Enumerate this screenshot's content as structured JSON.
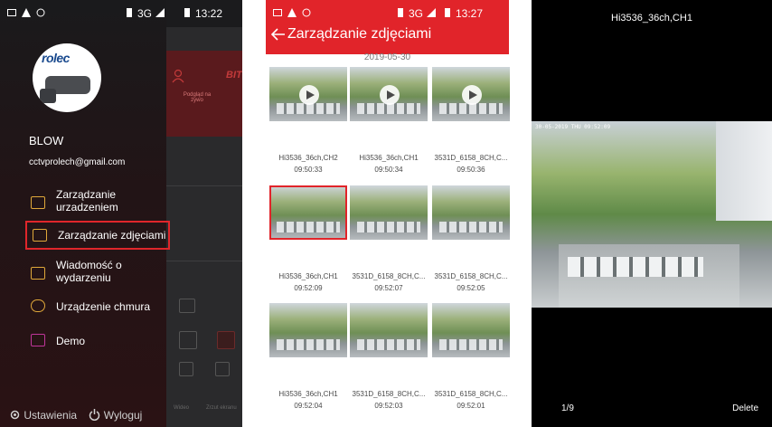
{
  "panel1": {
    "status": {
      "time": "13:22",
      "network": "3G"
    },
    "background_app": {
      "title_fragment": "BIT",
      "tab_label": "Podgląd na żywo",
      "bottom_labels": [
        "Wideo",
        "Zrzut ekranu"
      ]
    },
    "user": {
      "name": "BLOW",
      "email": "cctvprolech@gmail.com",
      "logo_text": "rolec"
    },
    "menu": [
      {
        "label": "Zarządzanie urzadzeniem",
        "icon": "camera-icon"
      },
      {
        "label": "Zarządzanie zdjęciami",
        "icon": "image-icon"
      },
      {
        "label": "Wiadomość o wydarzeniu",
        "icon": "message-icon"
      },
      {
        "label": "Urządzenie chmura",
        "icon": "cloud-icon"
      },
      {
        "label": "Demo",
        "icon": "demo-icon"
      }
    ],
    "bottom": {
      "settings": "Ustawienia",
      "logout": "Wyloguj"
    },
    "highlight_color": "#e0262b",
    "icon_color": "#e0a83a"
  },
  "panel2": {
    "status": {
      "time": "13:27",
      "network": "3G"
    },
    "title": "Zarządzanie zdjęciami",
    "date": "2019-05-30",
    "accent": "#e1242a",
    "items": [
      {
        "name": "Hi3536_36ch,CH2",
        "time": "09:50:33",
        "video": true
      },
      {
        "name": "Hi3536_36ch,CH1",
        "time": "09:50:34",
        "video": true
      },
      {
        "name": "3531D_6158_8CH,C...",
        "time": "09:50:36",
        "video": true
      },
      {
        "name": "Hi3536_36ch,CH1",
        "time": "09:52:09",
        "selected": true
      },
      {
        "name": "3531D_6158_8CH,C...",
        "time": "09:52:07"
      },
      {
        "name": "3531D_6158_8CH,C...",
        "time": "09:52:05"
      },
      {
        "name": "Hi3536_36ch,CH1",
        "time": "09:52:04"
      },
      {
        "name": "3531D_6158_8CH,C...",
        "time": "09:52:03"
      },
      {
        "name": "3531D_6158_8CH,C...",
        "time": "09:52:01"
      }
    ]
  },
  "panel3": {
    "title": "Hi3536_36ch,CH1",
    "stamp": "30-05-2019 THU 09:52:09",
    "counter": "1/9",
    "delete": "Delete"
  }
}
